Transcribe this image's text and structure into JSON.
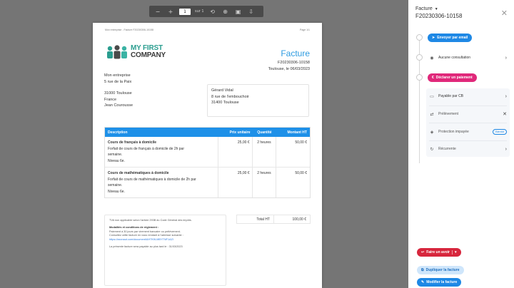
{
  "toolbar": {
    "page_current": "1",
    "page_total": "sur 1"
  },
  "document": {
    "header_left": "Mon entreprise - Facture F20230306-10158",
    "header_right": "Page 1/1",
    "logo_line1": "MY FIRST",
    "logo_line2": "COMPANY",
    "title": "Facture",
    "number": "F20230306-10158",
    "place_date": "Toulouse, le 06/03/2023",
    "from": {
      "name": "Mon entreprise",
      "street": "5 rue de la Paix",
      "city": "31000 Toulouse",
      "country": "France",
      "contact": "Jean Courousse"
    },
    "to": {
      "name": "Gérard Vidal",
      "street": "8 rue de l'embouchoir",
      "city": "31400 Toulouse"
    },
    "table": {
      "headers": [
        "Description",
        "Prix unitaire",
        "Quantité",
        "Montant HT"
      ],
      "rows": [
        {
          "title": "Cours de français à domicile",
          "line1": "Forfait de cours de français à domicile de 2h par",
          "line2": "semaine.",
          "line3": "Niveau 6e.",
          "unit": "25,00 €",
          "qty": "2 heures",
          "amount": "50,00 €"
        },
        {
          "title": "Cours de mathématiques à domicile",
          "line1": "Forfait de cours de mathématiques à domicile de 2h par",
          "line2": "semaine.",
          "line3": "Niveau 6e.",
          "unit": "25,00 €",
          "qty": "2 heures",
          "amount": "50,00 €"
        }
      ]
    },
    "notes": {
      "tva": "TVA non applicable selon l'article 293B du Code Général des impôts.",
      "conditions_title": "Modalités et conditions de règlement :",
      "conditions_line1": "Paiement à 30 jours par virement bancaire ou prélèvement.",
      "conditions_line2": "Consultez cette facture en vous rendant à l'adresse suivante :",
      "link": "https://axonaut.com/document/AHTK9LMBYTNF1AZI",
      "due": "La présente facture sera payable au plus tard le : 31/03/2023"
    },
    "totals": {
      "label": "Total HT",
      "value": "100,00 €"
    }
  },
  "panel": {
    "label": "Facture",
    "number": "F20230306-10158",
    "send_email": "Envoyer par email",
    "consultation": "Aucune consultation",
    "declare_payment": "Déclarer un paiement",
    "pay_cb": "Payable par CB",
    "prelevement": "Prélèvement",
    "protection": "Protection impayée",
    "protection_badge": "Bientôt",
    "recurrence": "Récurrente",
    "avoir": "Faire un avoir",
    "duplicate": "Dupliquer la facture",
    "edit": "Modifier la facture"
  },
  "colors": {
    "accent": "#1e88e5",
    "pink": "#e0287a",
    "red": "#d7263d",
    "brand_teal": "#2a9d8f"
  }
}
